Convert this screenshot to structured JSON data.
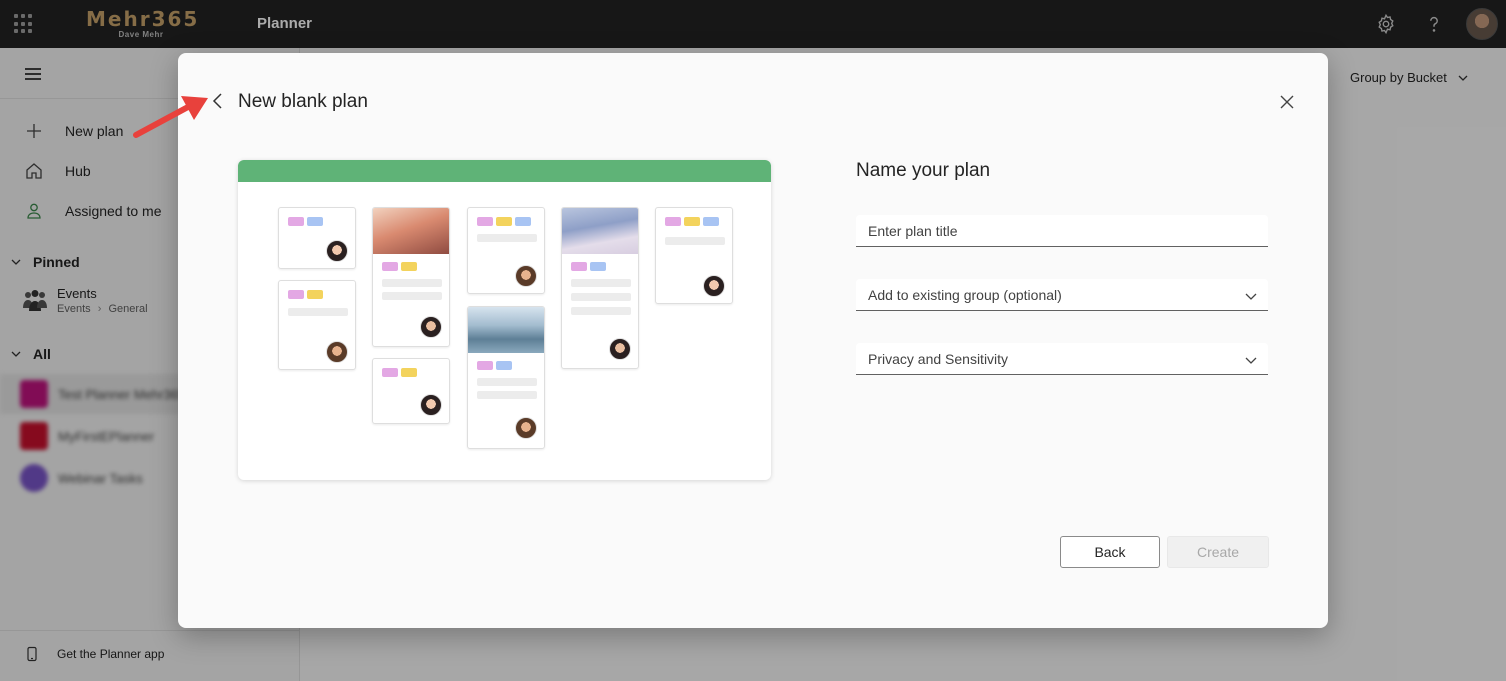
{
  "topbar": {
    "logo_main": "Mehr365",
    "logo_sub": "Dave Mehr",
    "app_name": "Planner",
    "icons": [
      "waffle-icon",
      "gear-icon",
      "help-icon",
      "avatar"
    ]
  },
  "sidebar": {
    "nav": [
      {
        "label": "New plan",
        "icon": "plus-icon"
      },
      {
        "label": "Hub",
        "icon": "home-icon"
      },
      {
        "label": "Assigned to me",
        "icon": "person-icon"
      }
    ],
    "pinned_label": "Pinned",
    "pinned": {
      "title": "Events",
      "path_group": "Events",
      "path_channel": "General"
    },
    "all_label": "All",
    "blurred_plans": [
      {
        "label": "Test Planner Mehr365",
        "color": "#c0137f"
      },
      {
        "label": "MyFirstEPlanner",
        "color": "#c8102e"
      },
      {
        "label": "Webinar Tasks",
        "color": "#7a55c9"
      }
    ],
    "get_app": "Get the Planner app"
  },
  "main": {
    "group_by": "Group by Bucket"
  },
  "dialog": {
    "title": "New blank plan",
    "form_title": "Name your plan",
    "title_placeholder": "Enter plan title",
    "group_select": "Add to existing group (optional)",
    "privacy_select": "Privacy and Sensitivity",
    "back_label": "Back",
    "create_label": "Create"
  },
  "colors": {
    "topbar": "#232323",
    "accent_green": "#5fb377",
    "annotation_arrow": "#e8413c"
  }
}
